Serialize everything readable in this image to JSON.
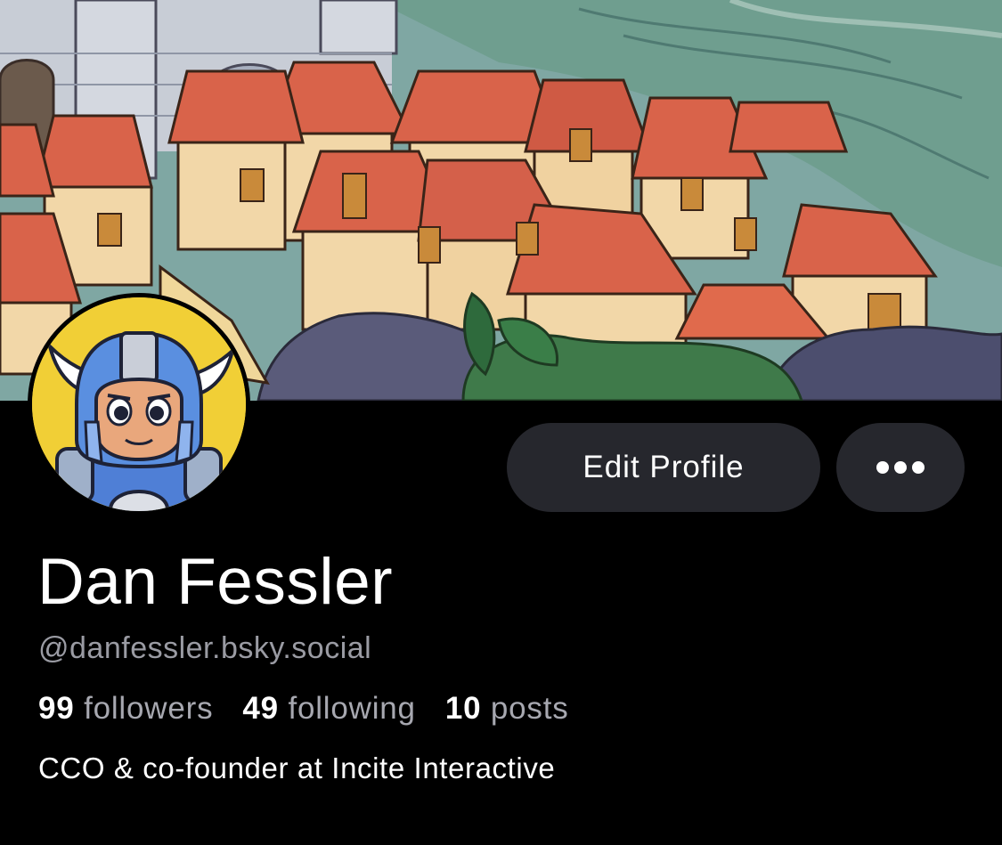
{
  "profile": {
    "display_name": "Dan Fessler",
    "handle": "@danfessler.bsky.social",
    "bio": "CCO & co-founder at Incite Interactive",
    "stats": {
      "followers_count": "99",
      "followers_label": "followers",
      "following_count": "49",
      "following_label": "following",
      "posts_count": "10",
      "posts_label": "posts"
    }
  },
  "actions": {
    "edit_profile_label": "Edit Profile",
    "more_icon": "ellipsis-icon"
  },
  "colors": {
    "background": "#000000",
    "button_bg": "#26272d",
    "secondary_text": "#9a9ba3",
    "avatar_bg": "#f1cf36"
  }
}
